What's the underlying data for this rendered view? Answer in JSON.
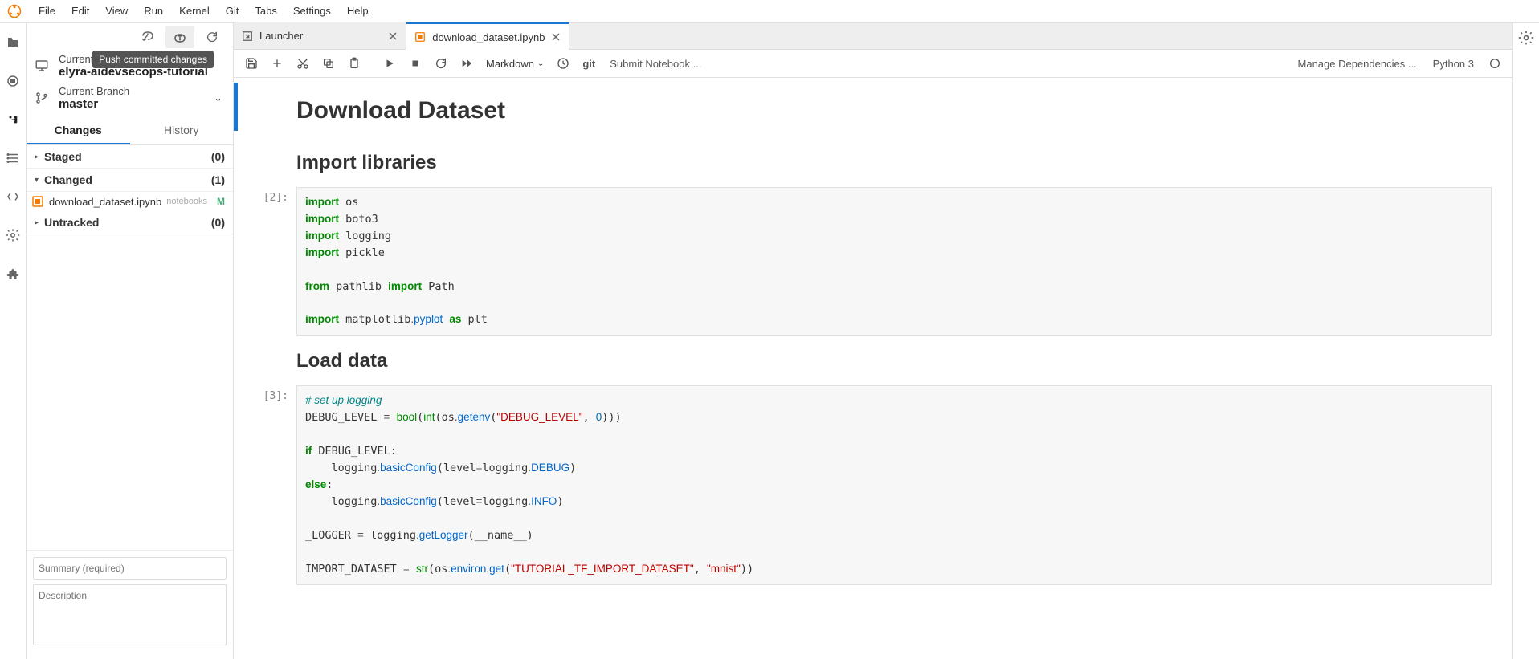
{
  "menu": [
    "File",
    "Edit",
    "View",
    "Run",
    "Kernel",
    "Git",
    "Tabs",
    "Settings",
    "Help"
  ],
  "tooltip": "Push committed changes",
  "repo": {
    "label": "Current Repository",
    "name": "elyra-aidevsecops-tutorial"
  },
  "branch": {
    "label": "Current Branch",
    "name": "master"
  },
  "gittabs": {
    "changes": "Changes",
    "history": "History"
  },
  "sections": {
    "staged": {
      "title": "Staged",
      "count": "(0)"
    },
    "changed": {
      "title": "Changed",
      "count": "(1)"
    },
    "untracked": {
      "title": "Untracked",
      "count": "(0)"
    }
  },
  "changed_file": {
    "name": "download_dataset.ipynb",
    "path": "notebooks",
    "status": "M"
  },
  "commit": {
    "summary_ph": "Summary (required)",
    "desc_ph": "Description"
  },
  "tabs": {
    "launcher": "Launcher",
    "notebook": "download_dataset.ipynb"
  },
  "nbtoolbar": {
    "celltype": "Markdown",
    "git": "git",
    "submit": "Submit Notebook ...",
    "deps": "Manage Dependencies ...",
    "kernel": "Python 3"
  },
  "nb": {
    "h1": "Download Dataset",
    "h2a": "Import libraries",
    "h2b": "Load data",
    "p2": "[2]:",
    "p3": "[3]:"
  }
}
